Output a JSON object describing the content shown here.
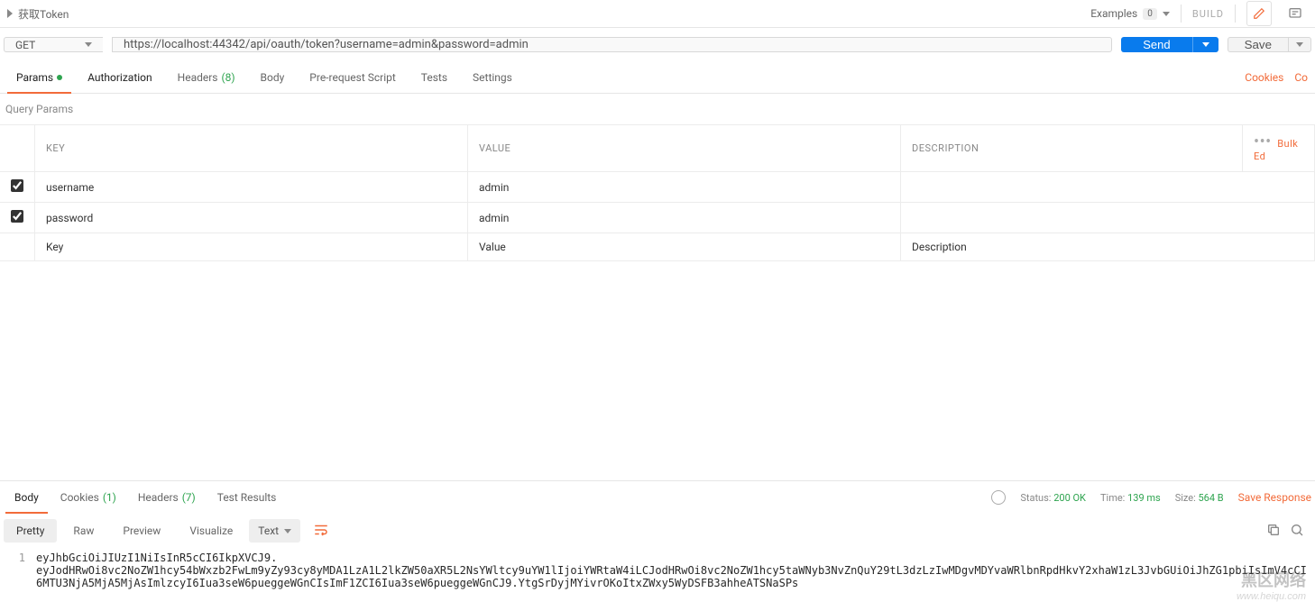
{
  "header": {
    "tab_name": "获取Token",
    "examples_label": "Examples",
    "examples_count": "0",
    "build_label": "BUILD"
  },
  "request": {
    "method": "GET",
    "url": "https://localhost:44342/api/oauth/token?username=admin&password=admin",
    "send_label": "Send",
    "save_label": "Save"
  },
  "tabs": {
    "params": "Params",
    "authorization": "Authorization",
    "headers": "Headers",
    "headers_count": "(8)",
    "body": "Body",
    "prerequest": "Pre-request Script",
    "tests": "Tests",
    "settings": "Settings",
    "cookies_link": "Cookies",
    "code_link": "Co"
  },
  "query": {
    "title": "Query Params",
    "col_key": "KEY",
    "col_value": "VALUE",
    "col_desc": "DESCRIPTION",
    "bulk_edit": "Bulk Ed",
    "rows": [
      {
        "enabled": true,
        "key": "username",
        "value": "admin",
        "desc": ""
      },
      {
        "enabled": true,
        "key": "password",
        "value": "admin",
        "desc": ""
      }
    ],
    "ph_key": "Key",
    "ph_value": "Value",
    "ph_desc": "Description"
  },
  "response": {
    "tabs": {
      "body": "Body",
      "cookies": "Cookies",
      "cookies_count": "(1)",
      "headers": "Headers",
      "headers_count": "(7)",
      "tests": "Test Results"
    },
    "status_label": "Status:",
    "status_value": "200 OK",
    "time_label": "Time:",
    "time_value": "139 ms",
    "size_label": "Size:",
    "size_value": "564 B",
    "save_response": "Save Response",
    "toolbar": {
      "pretty": "Pretty",
      "raw": "Raw",
      "preview": "Preview",
      "visualize": "Visualize",
      "format": "Text"
    },
    "line_no": "1",
    "body_text": "eyJhbGciOiJIUzI1NiIsInR5cCI6IkpXVCJ9.\neyJodHRwOi8vc2NoZW1hcy54bWxzb2FwLm9yZy93cy8yMDA1LzA1L2lkZW50aXR5L2NsYWltcy9uYW1lIjoiYWRtaW4iLCJodHRwOi8vc2NoZW1hcy5taWNyb3NvZnQuY29tL3dzLzIwMDgvMDYvaWRlbnRpdHkvY2xhaW1zL3JvbGUiOiJhZG1pbiIsImV4cCI6MTU3NjA5MjA5MjAsImlzcyI6Iua3seW6pueggeWGnCIsImF1ZCI6Iua3seW6pueggeWGnCJ9.YtgSrDyjMYivrOKoItxZWxy5WyDSFB3ahheATSNaSPs"
  },
  "watermark": {
    "cn": "黑区网络",
    "en": "www.heiqu.com"
  }
}
